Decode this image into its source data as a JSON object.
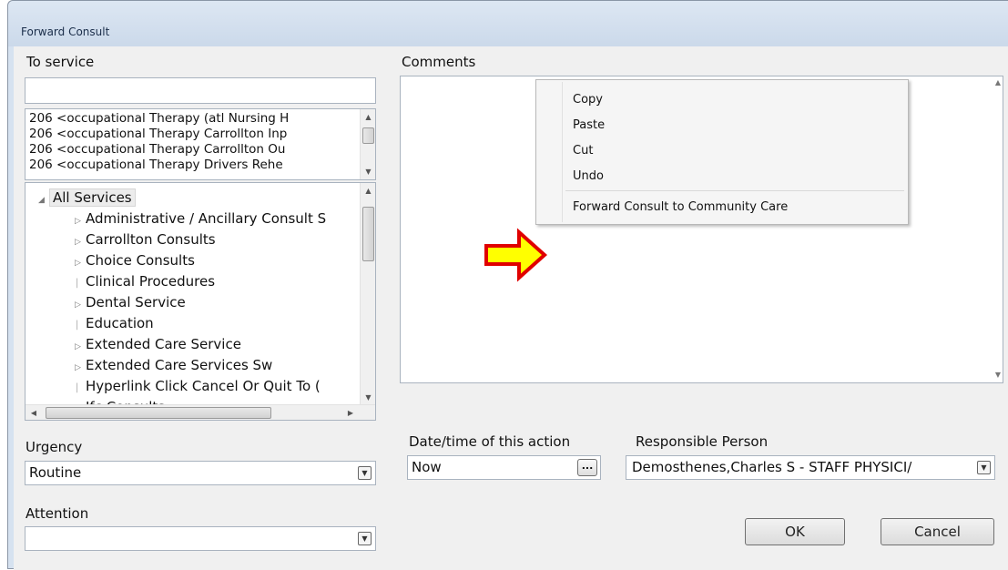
{
  "window": {
    "title": "Forward Consult"
  },
  "to_service": {
    "label": "To service",
    "search_value": "",
    "list": [
      "206  <occupational Therapy (atl Nursing H",
      "206  <occupational Therapy Carrollton Inp",
      "206  <occupational Therapy Carrollton Ou",
      "206  <occupational Therapy Drivers Rehe"
    ],
    "tree": {
      "root": "All Services",
      "items": [
        "Administrative / Ancillary Consult S",
        "Carrollton Consults",
        "Choice Consults",
        "Clinical Procedures",
        "Dental Service",
        "Education",
        "Extended Care Service",
        "Extended Care Services Sw",
        "Hyperlink Click Cancel Or Quit To (",
        "Ifc Consults"
      ]
    }
  },
  "comments": {
    "label": "Comments",
    "value": ""
  },
  "context_menu": {
    "items": [
      "Copy",
      "Paste",
      "Cut",
      "Undo",
      "Forward Consult to Community Care"
    ]
  },
  "urgency": {
    "label": "Urgency",
    "value": "Routine"
  },
  "attention": {
    "label": "Attention",
    "value": ""
  },
  "datetime": {
    "label": "Date/time of this action",
    "value": "Now",
    "button": "..."
  },
  "responsible": {
    "label": "Responsible Person",
    "value": "Demosthenes,Charles S - STAFF PHYSICI/"
  },
  "buttons": {
    "ok": "OK",
    "cancel": "Cancel"
  },
  "colors": {
    "arrow_fill": "#ffff00",
    "arrow_stroke": "#e00000"
  },
  "icons": {
    "scroll_up": "triangle-up",
    "scroll_down": "triangle-down",
    "expand": "triangle-right",
    "collapse": "triangle-down-left",
    "dropdown": "triangle-down"
  }
}
